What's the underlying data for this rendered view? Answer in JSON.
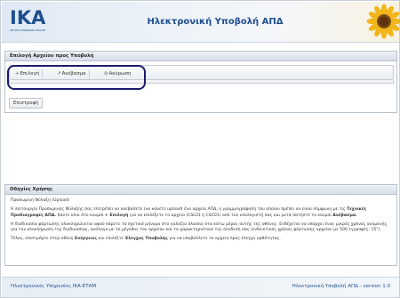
{
  "header": {
    "logo_text": "IKA",
    "logo_subtitle": "ΙΔΡΥΜΑ ΚΟΙΝΩΝΙΚΩΝ ΑΣΦΑΛΙΣΕΩΝ",
    "title": "Ηλεκτρονική Υποβολή ΑΠΔ"
  },
  "upload_panel": {
    "title": "Επιλογή Αρχείου προς Υποβολή",
    "toolbar": {
      "select_label": "Επιλογή",
      "upload_label": "Ανέβασμα",
      "cancel_label": "Ακύρωση"
    },
    "back_label": "Επιστροφή"
  },
  "info_panel": {
    "title": "Οδηγίες Χρήσης",
    "p1": "Προσωρινή Φύλαξη (Upload)",
    "p2a": "Η λειτουργία Προσωρινής Φύλαξης σας επιτρέπει να ανεβάσετε (να κάνετε upload) ένα αρχείο ΑΠΔ, η γραμμογράφηση του οποίου πρέπει να είναι σύμφωνη με τις ",
    "p2b": "Τεχνικές Προδιαγραφές ΑΠΔ.",
    "p2c": " Κάντε κλικ στο κουμπί ",
    "p2d": "+ Επιλογή",
    "p2e": " για να επιλέξετε το αρχείο (CSL01 ή CSC01) από τον υπολογιστή σας και μετά πατήστε το κουμπί ",
    "p2f": "Ανέβασμα.",
    "p3": "Η διαδικασία φόρτωσης ολοκληρώνεται αφού πάρετε το σχετικό μήνυμα στο γαλάζιο πλαίσιο στο κάτω μέρος αυτής της οθόνης. Ενδέχεται να υπάρχει ένας μικρός χρόνος αναμονής για την ολοκλήρωση της διαδικασίας, ανάλογα με το μέγεθος του αρχείου και τα χαρακτηριστικά της σύνδεσή σας (ενδεικτικός χρόνος φόρτωσης αρχείου με 500 εγγραφές: 15\").",
    "p4a": "Τέλος, επιστρέψτε στην οθόνη ",
    "p4b": "Ενέργειες",
    "p4c": " και επιλέξτε ",
    "p4d": "Έλεγχος Υποβολής",
    "p4e": " για να υποβάλλετε το αρχείο προς έλεγχο ορθότητας."
  },
  "footer": {
    "left": "Ηλεκτρονικές Υπηρεσίες ΙΚΑ-ΕΤΑΜ",
    "right": "Ηλεκτρονική Υποβολή ΑΠΔ - version 1.0"
  },
  "colors": {
    "brand_blue": "#1f4f8f",
    "highlight_ring": "#1b1b6b"
  },
  "icons": [
    "plus-icon",
    "upload-icon",
    "cancel-icon",
    "sunflower-icon"
  ]
}
